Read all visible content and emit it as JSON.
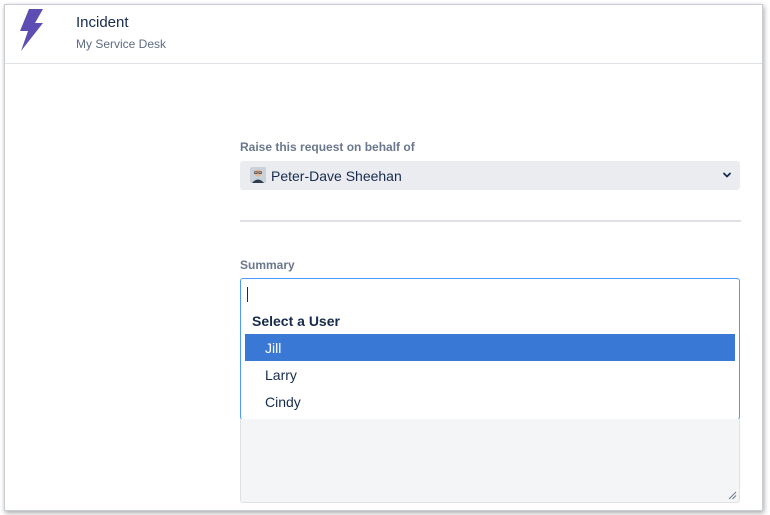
{
  "header": {
    "title": "Incident",
    "subtitle": "My Service Desk",
    "logo_icon": "lightning-bolt-icon",
    "logo_color": "#5e4db2"
  },
  "form": {
    "behalf_label": "Raise this request on behalf of",
    "behalf_value": "Peter-Dave Sheehan",
    "summary_label": "Summary",
    "summary_value": ""
  },
  "dropdown": {
    "header": "Select a User",
    "items": [
      {
        "label": "Jill",
        "selected": true
      },
      {
        "label": "Larry",
        "selected": false
      },
      {
        "label": "Cindy",
        "selected": false
      }
    ],
    "highlight_color": "#3a78d6"
  }
}
